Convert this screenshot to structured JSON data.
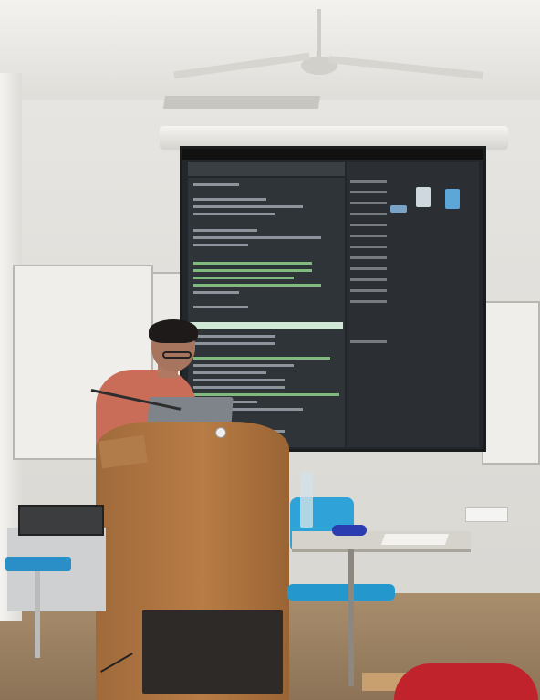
{
  "scene": {
    "description_colors": {
      "wall": "#e0ded9",
      "floor": "#9b8062",
      "screen_bg": "#22272b",
      "terminal_bg": "#2f3439",
      "shirt": "#c96d59",
      "podium_wood": "#b07743",
      "chair_blue": "#2fa3d8",
      "chair_red": "#c1232c"
    },
    "icons": [
      "ceiling-fan-icon",
      "water-bottle-icon",
      "laptop-icon",
      "microphone-icon"
    ]
  }
}
